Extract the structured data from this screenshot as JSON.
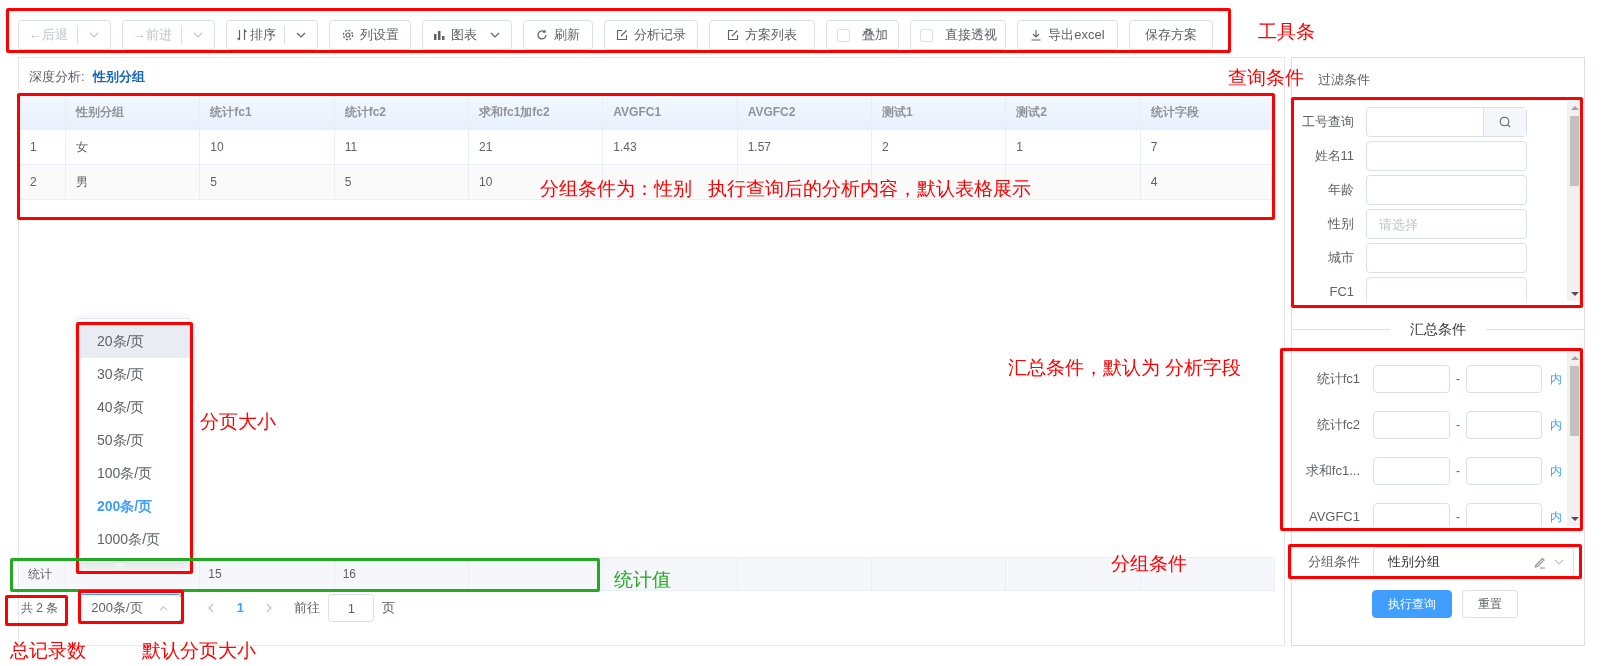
{
  "toolbar": [
    {
      "kind": "split",
      "label": "←后退",
      "disabled": true
    },
    {
      "kind": "split",
      "label": "→前进",
      "disabled": true
    },
    {
      "kind": "split",
      "label": "排序",
      "disabled": false
    },
    {
      "kind": "button",
      "label": "列设置",
      "disabled": false
    },
    {
      "kind": "dropdown",
      "label": "图表",
      "disabled": false
    },
    {
      "kind": "button",
      "label": "刷新",
      "disabled": false
    },
    {
      "kind": "button",
      "label": "分析记录",
      "disabled": false
    },
    {
      "kind": "button",
      "label": "方案列表",
      "disabled": false
    },
    {
      "kind": "checkbox",
      "label": "叠加",
      "disabled": false,
      "checked": false
    },
    {
      "kind": "checkbox",
      "label": "直接透视",
      "disabled": false,
      "checked": false
    },
    {
      "kind": "button",
      "label": "导出excel",
      "disabled": false
    },
    {
      "kind": "button",
      "label": "保存方案",
      "disabled": false
    }
  ],
  "breadcrumb": {
    "label": "深度分析:",
    "value": "性别分组"
  },
  "table": {
    "columns": [
      "",
      "性别分组",
      "统计fc1",
      "统计fc2",
      "求和fc1加fc2",
      "AVGFC1",
      "AVGFC2",
      "测试1",
      "测试2",
      "统计字段"
    ],
    "rows": [
      [
        "1",
        "女",
        "10",
        "11",
        "21",
        "1.43",
        "1.57",
        "2",
        "1",
        "7"
      ],
      [
        "2",
        "男",
        "5",
        "5",
        "10",
        null,
        null,
        null,
        null,
        "4"
      ]
    ],
    "summary": {
      "label": "统计",
      "values": [
        "15",
        "16"
      ]
    }
  },
  "pagination": {
    "total": "共 2 条",
    "page_size": "200条/页",
    "pages": [
      {
        "label": "1",
        "selected": true
      }
    ],
    "goto_label": "前往",
    "goto_value": "1",
    "goto_suffix": "页"
  },
  "page_size_menu": {
    "options": [
      {
        "label": "20条/页",
        "selected": false,
        "hovered": true
      },
      {
        "label": "30条/页",
        "selected": false,
        "hovered": false
      },
      {
        "label": "40条/页",
        "selected": false,
        "hovered": false
      },
      {
        "label": "50条/页",
        "selected": false,
        "hovered": false
      },
      {
        "label": "100条/页",
        "selected": false,
        "hovered": false
      },
      {
        "label": "200条/页",
        "selected": true,
        "hovered": false
      },
      {
        "label": "1000条/页",
        "selected": false,
        "hovered": false
      }
    ]
  },
  "filter": {
    "title": "过滤条件",
    "fields": [
      {
        "label": "工号查询",
        "kind": "search"
      },
      {
        "label": "姓名11",
        "kind": "text"
      },
      {
        "label": "年龄",
        "kind": "text"
      },
      {
        "label": "性别",
        "kind": "select",
        "placeholder": "请选择"
      },
      {
        "label": "城市",
        "kind": "text"
      },
      {
        "label": "FC1",
        "kind": "text"
      }
    ]
  },
  "summary_conditions": {
    "title": "汇总条件",
    "rows": [
      {
        "label": "统计fc1",
        "separator": "-",
        "suffix": "内"
      },
      {
        "label": "统计fc2",
        "separator": "-",
        "suffix": "内"
      },
      {
        "label": "求和fc1...",
        "separator": "-",
        "suffix": "内"
      },
      {
        "label": "AVGFC1",
        "separator": "-",
        "suffix": "内"
      }
    ]
  },
  "group_condition": {
    "label": "分组条件",
    "value": "性别分组"
  },
  "actions": [
    {
      "label": "执行查询",
      "kind": "primary"
    },
    {
      "label": "重置",
      "kind": "default"
    }
  ],
  "annotations": [
    {
      "text": "工具条",
      "color": "#ff0000"
    },
    {
      "text": "查询条件",
      "color": "#ff0000"
    },
    {
      "text": "分组条件为：性别   执行查询后的分析内容，默认表格展示",
      "color": "#ff0000"
    },
    {
      "text": "汇总条件，默认为 分析字段",
      "color": "#ff0000"
    },
    {
      "text": "分组条件",
      "color": "#ff0000"
    },
    {
      "text": "分页大小",
      "color": "#ff0000"
    },
    {
      "text": "统计值",
      "color": "#22aa22"
    },
    {
      "text": "总记录数",
      "color": "#ff0000"
    },
    {
      "text": "默认分页大小",
      "color": "#ff0000"
    }
  ]
}
